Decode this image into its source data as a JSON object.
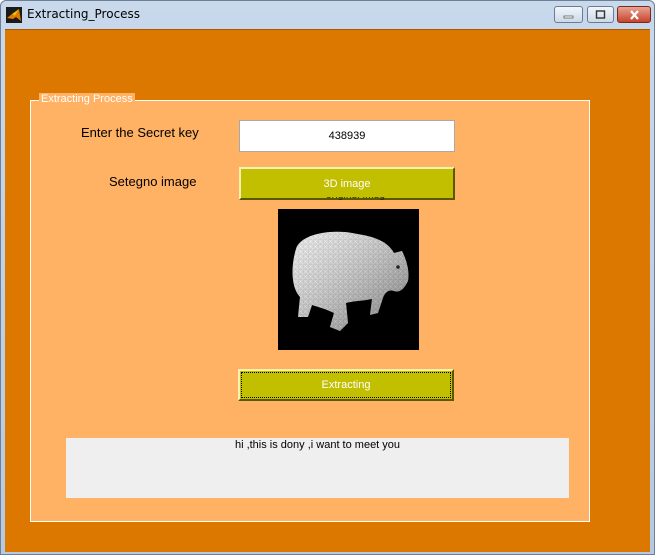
{
  "window": {
    "title": "Extracting_Process",
    "icon": "matlab-icon",
    "controls": [
      "minimize-icon",
      "maximize-icon",
      "close-icon"
    ]
  },
  "panel": {
    "title": "Extracting Process"
  },
  "form": {
    "key_label": "Enter the Secret key",
    "key_value": "438939",
    "image_label": "Setegno  image",
    "image_button_label": "3D image",
    "image_icon": "3d-bear-model-icon",
    "extract_button_label": "Extracting",
    "message": "hi ,this is dony ,i want to meet you"
  },
  "colors": {
    "background": "#dc7700",
    "panel": "#ffb164",
    "button": "#c2be00",
    "message_box": "#efefef"
  }
}
